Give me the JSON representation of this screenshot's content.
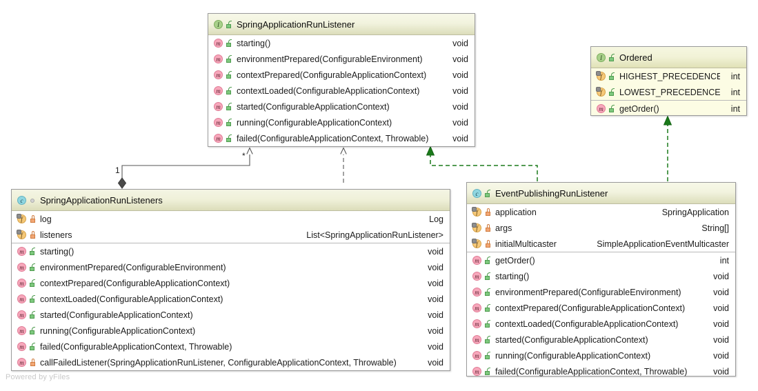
{
  "diagram": {
    "watermark": "Powered by yFiles",
    "colors": {
      "interface_icon": "#a8d08a",
      "class_icon": "#8fd6e0",
      "method_icon": "#f7a7bb",
      "field_icon": "#f5c878",
      "public_visibility": "#4e9b4e",
      "private_visibility": "#cf7b3e",
      "header_gradient_top": "#f7f8e8",
      "header_gradient_bottom": "#dcddbb",
      "ordered_body": "#fcfce4",
      "realization_edge": "#1a7a1a",
      "inheritance_edge": "#555555"
    }
  },
  "classes": {
    "spring_application_run_listener": {
      "name": "SpringApplicationRunListener",
      "stereotype_icon": "interface-icon",
      "visibility_icon": "public-icon",
      "members": [
        {
          "icon": "method-icon",
          "visibility": "public",
          "name": "starting()",
          "type": "void"
        },
        {
          "icon": "method-icon",
          "visibility": "public",
          "name": "environmentPrepared(ConfigurableEnvironment)",
          "type": "void"
        },
        {
          "icon": "method-icon",
          "visibility": "public",
          "name": "contextPrepared(ConfigurableApplicationContext)",
          "type": "void"
        },
        {
          "icon": "method-icon",
          "visibility": "public",
          "name": "contextLoaded(ConfigurableApplicationContext)",
          "type": "void"
        },
        {
          "icon": "method-icon",
          "visibility": "public",
          "name": "started(ConfigurableApplicationContext)",
          "type": "void"
        },
        {
          "icon": "method-icon",
          "visibility": "public",
          "name": "running(ConfigurableApplicationContext)",
          "type": "void"
        },
        {
          "icon": "method-icon",
          "visibility": "public",
          "name": "failed(ConfigurableApplicationContext, Throwable)",
          "type": "void"
        }
      ]
    },
    "ordered": {
      "name": "Ordered",
      "stereotype_icon": "interface-icon",
      "visibility_icon": "public-icon",
      "fields": [
        {
          "icon": "static-field-icon",
          "visibility": "public",
          "name": "HIGHEST_PRECEDENCE",
          "type": "int"
        },
        {
          "icon": "static-field-icon",
          "visibility": "public",
          "name": "LOWEST_PRECEDENCE",
          "type": "int"
        }
      ],
      "methods": [
        {
          "icon": "method-icon",
          "visibility": "public",
          "name": "getOrder()",
          "type": "int"
        }
      ]
    },
    "spring_application_run_listeners": {
      "name": "SpringApplicationRunListeners",
      "stereotype_icon": "class-icon",
      "visibility_icon": "package-private-icon",
      "fields": [
        {
          "icon": "static-field-icon",
          "visibility": "private",
          "name": "log",
          "type": "Log"
        },
        {
          "icon": "static-field-icon",
          "visibility": "private",
          "name": "listeners",
          "type": "List<SpringApplicationRunListener>"
        }
      ],
      "methods": [
        {
          "icon": "method-icon",
          "visibility": "public",
          "name": "starting()",
          "type": "void"
        },
        {
          "icon": "method-icon",
          "visibility": "public",
          "name": "environmentPrepared(ConfigurableEnvironment)",
          "type": "void"
        },
        {
          "icon": "method-icon",
          "visibility": "public",
          "name": "contextPrepared(ConfigurableApplicationContext)",
          "type": "void"
        },
        {
          "icon": "method-icon",
          "visibility": "public",
          "name": "contextLoaded(ConfigurableApplicationContext)",
          "type": "void"
        },
        {
          "icon": "method-icon",
          "visibility": "public",
          "name": "started(ConfigurableApplicationContext)",
          "type": "void"
        },
        {
          "icon": "method-icon",
          "visibility": "public",
          "name": "running(ConfigurableApplicationContext)",
          "type": "void"
        },
        {
          "icon": "method-icon",
          "visibility": "public",
          "name": "failed(ConfigurableApplicationContext, Throwable)",
          "type": "void"
        },
        {
          "icon": "method-icon",
          "visibility": "private",
          "name": "callFailedListener(SpringApplicationRunListener, ConfigurableApplicationContext, Throwable)",
          "type": "void"
        }
      ]
    },
    "event_publishing_run_listener": {
      "name": "EventPublishingRunListener",
      "stereotype_icon": "class-icon",
      "visibility_icon": "public-icon",
      "fields": [
        {
          "icon": "static-field-icon",
          "visibility": "private",
          "name": "application",
          "type": "SpringApplication"
        },
        {
          "icon": "static-field-icon",
          "visibility": "private",
          "name": "args",
          "type": "String[]"
        },
        {
          "icon": "static-field-icon",
          "visibility": "private",
          "name": "initialMulticaster",
          "type": "SimpleApplicationEventMulticaster"
        }
      ],
      "methods": [
        {
          "icon": "method-icon",
          "visibility": "public",
          "name": "getOrder()",
          "type": "int"
        },
        {
          "icon": "method-icon",
          "visibility": "public",
          "name": "starting()",
          "type": "void"
        },
        {
          "icon": "method-icon",
          "visibility": "public",
          "name": "environmentPrepared(ConfigurableEnvironment)",
          "type": "void"
        },
        {
          "icon": "method-icon",
          "visibility": "public",
          "name": "contextPrepared(ConfigurableApplicationContext)",
          "type": "void"
        },
        {
          "icon": "method-icon",
          "visibility": "public",
          "name": "contextLoaded(ConfigurableApplicationContext)",
          "type": "void"
        },
        {
          "icon": "method-icon",
          "visibility": "public",
          "name": "started(ConfigurableApplicationContext)",
          "type": "void"
        },
        {
          "icon": "method-icon",
          "visibility": "public",
          "name": "running(ConfigurableApplicationContext)",
          "type": "void"
        },
        {
          "icon": "method-icon",
          "visibility": "public",
          "name": "failed(ConfigurableApplicationContext, Throwable)",
          "type": "void"
        }
      ]
    }
  },
  "edges": {
    "composition": {
      "source_multiplicity": "1",
      "target_multiplicity": "*",
      "from": "SpringApplicationRunListeners",
      "to": "SpringApplicationRunListener"
    },
    "realization_listeners": {
      "from": "SpringApplicationRunListeners",
      "to": "SpringApplicationRunListener"
    },
    "realization_event": {
      "from": "EventPublishingRunListener",
      "to": "SpringApplicationRunListener"
    },
    "realization_ordered": {
      "from": "EventPublishingRunListener",
      "to": "Ordered"
    }
  }
}
